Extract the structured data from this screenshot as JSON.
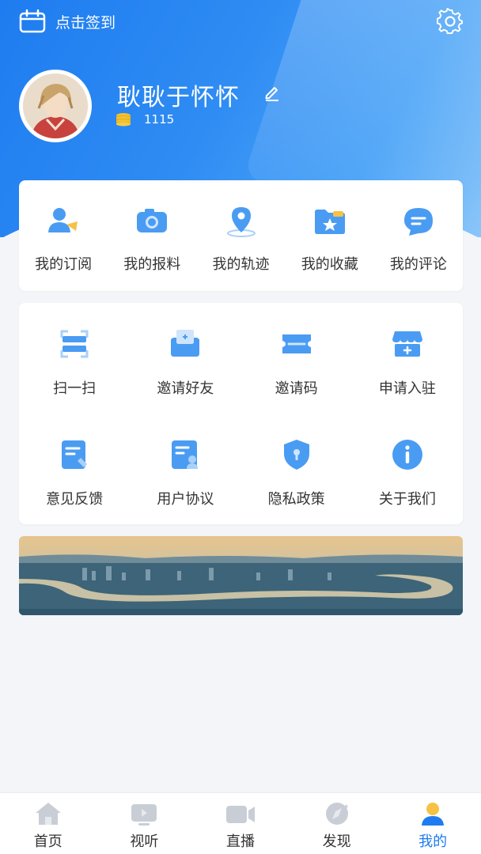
{
  "header": {
    "checkin_label": "点击签到",
    "username": "耿耿于怀怀",
    "coins": "1115"
  },
  "colors": {
    "primary": "#1e7cf0",
    "icon_blue": "#4a9cf3",
    "coin_gold": "#f2c230"
  },
  "quick_actions": [
    {
      "label": "我的订阅",
      "icon": "subscribe-icon"
    },
    {
      "label": "我的报料",
      "icon": "camera-icon"
    },
    {
      "label": "我的轨迹",
      "icon": "location-icon"
    },
    {
      "label": "我的收藏",
      "icon": "favorites-folder-icon"
    },
    {
      "label": "我的评论",
      "icon": "comment-icon"
    }
  ],
  "tools": [
    {
      "label": "扫一扫",
      "icon": "scan-icon"
    },
    {
      "label": "邀请好友",
      "icon": "invite-mail-icon"
    },
    {
      "label": "邀请码",
      "icon": "ticket-icon"
    },
    {
      "label": "申请入驻",
      "icon": "store-icon"
    },
    {
      "label": "意见反馈",
      "icon": "feedback-icon"
    },
    {
      "label": "用户协议",
      "icon": "agreement-icon"
    },
    {
      "label": "隐私政策",
      "icon": "shield-icon"
    },
    {
      "label": "关于我们",
      "icon": "info-icon"
    }
  ],
  "tabbar": [
    {
      "label": "首页",
      "icon": "home-icon",
      "active": false
    },
    {
      "label": "视听",
      "icon": "tv-icon",
      "active": false
    },
    {
      "label": "直播",
      "icon": "video-camera-icon",
      "active": false
    },
    {
      "label": "发现",
      "icon": "compass-icon",
      "active": false
    },
    {
      "label": "我的",
      "icon": "user-icon",
      "active": true
    }
  ]
}
